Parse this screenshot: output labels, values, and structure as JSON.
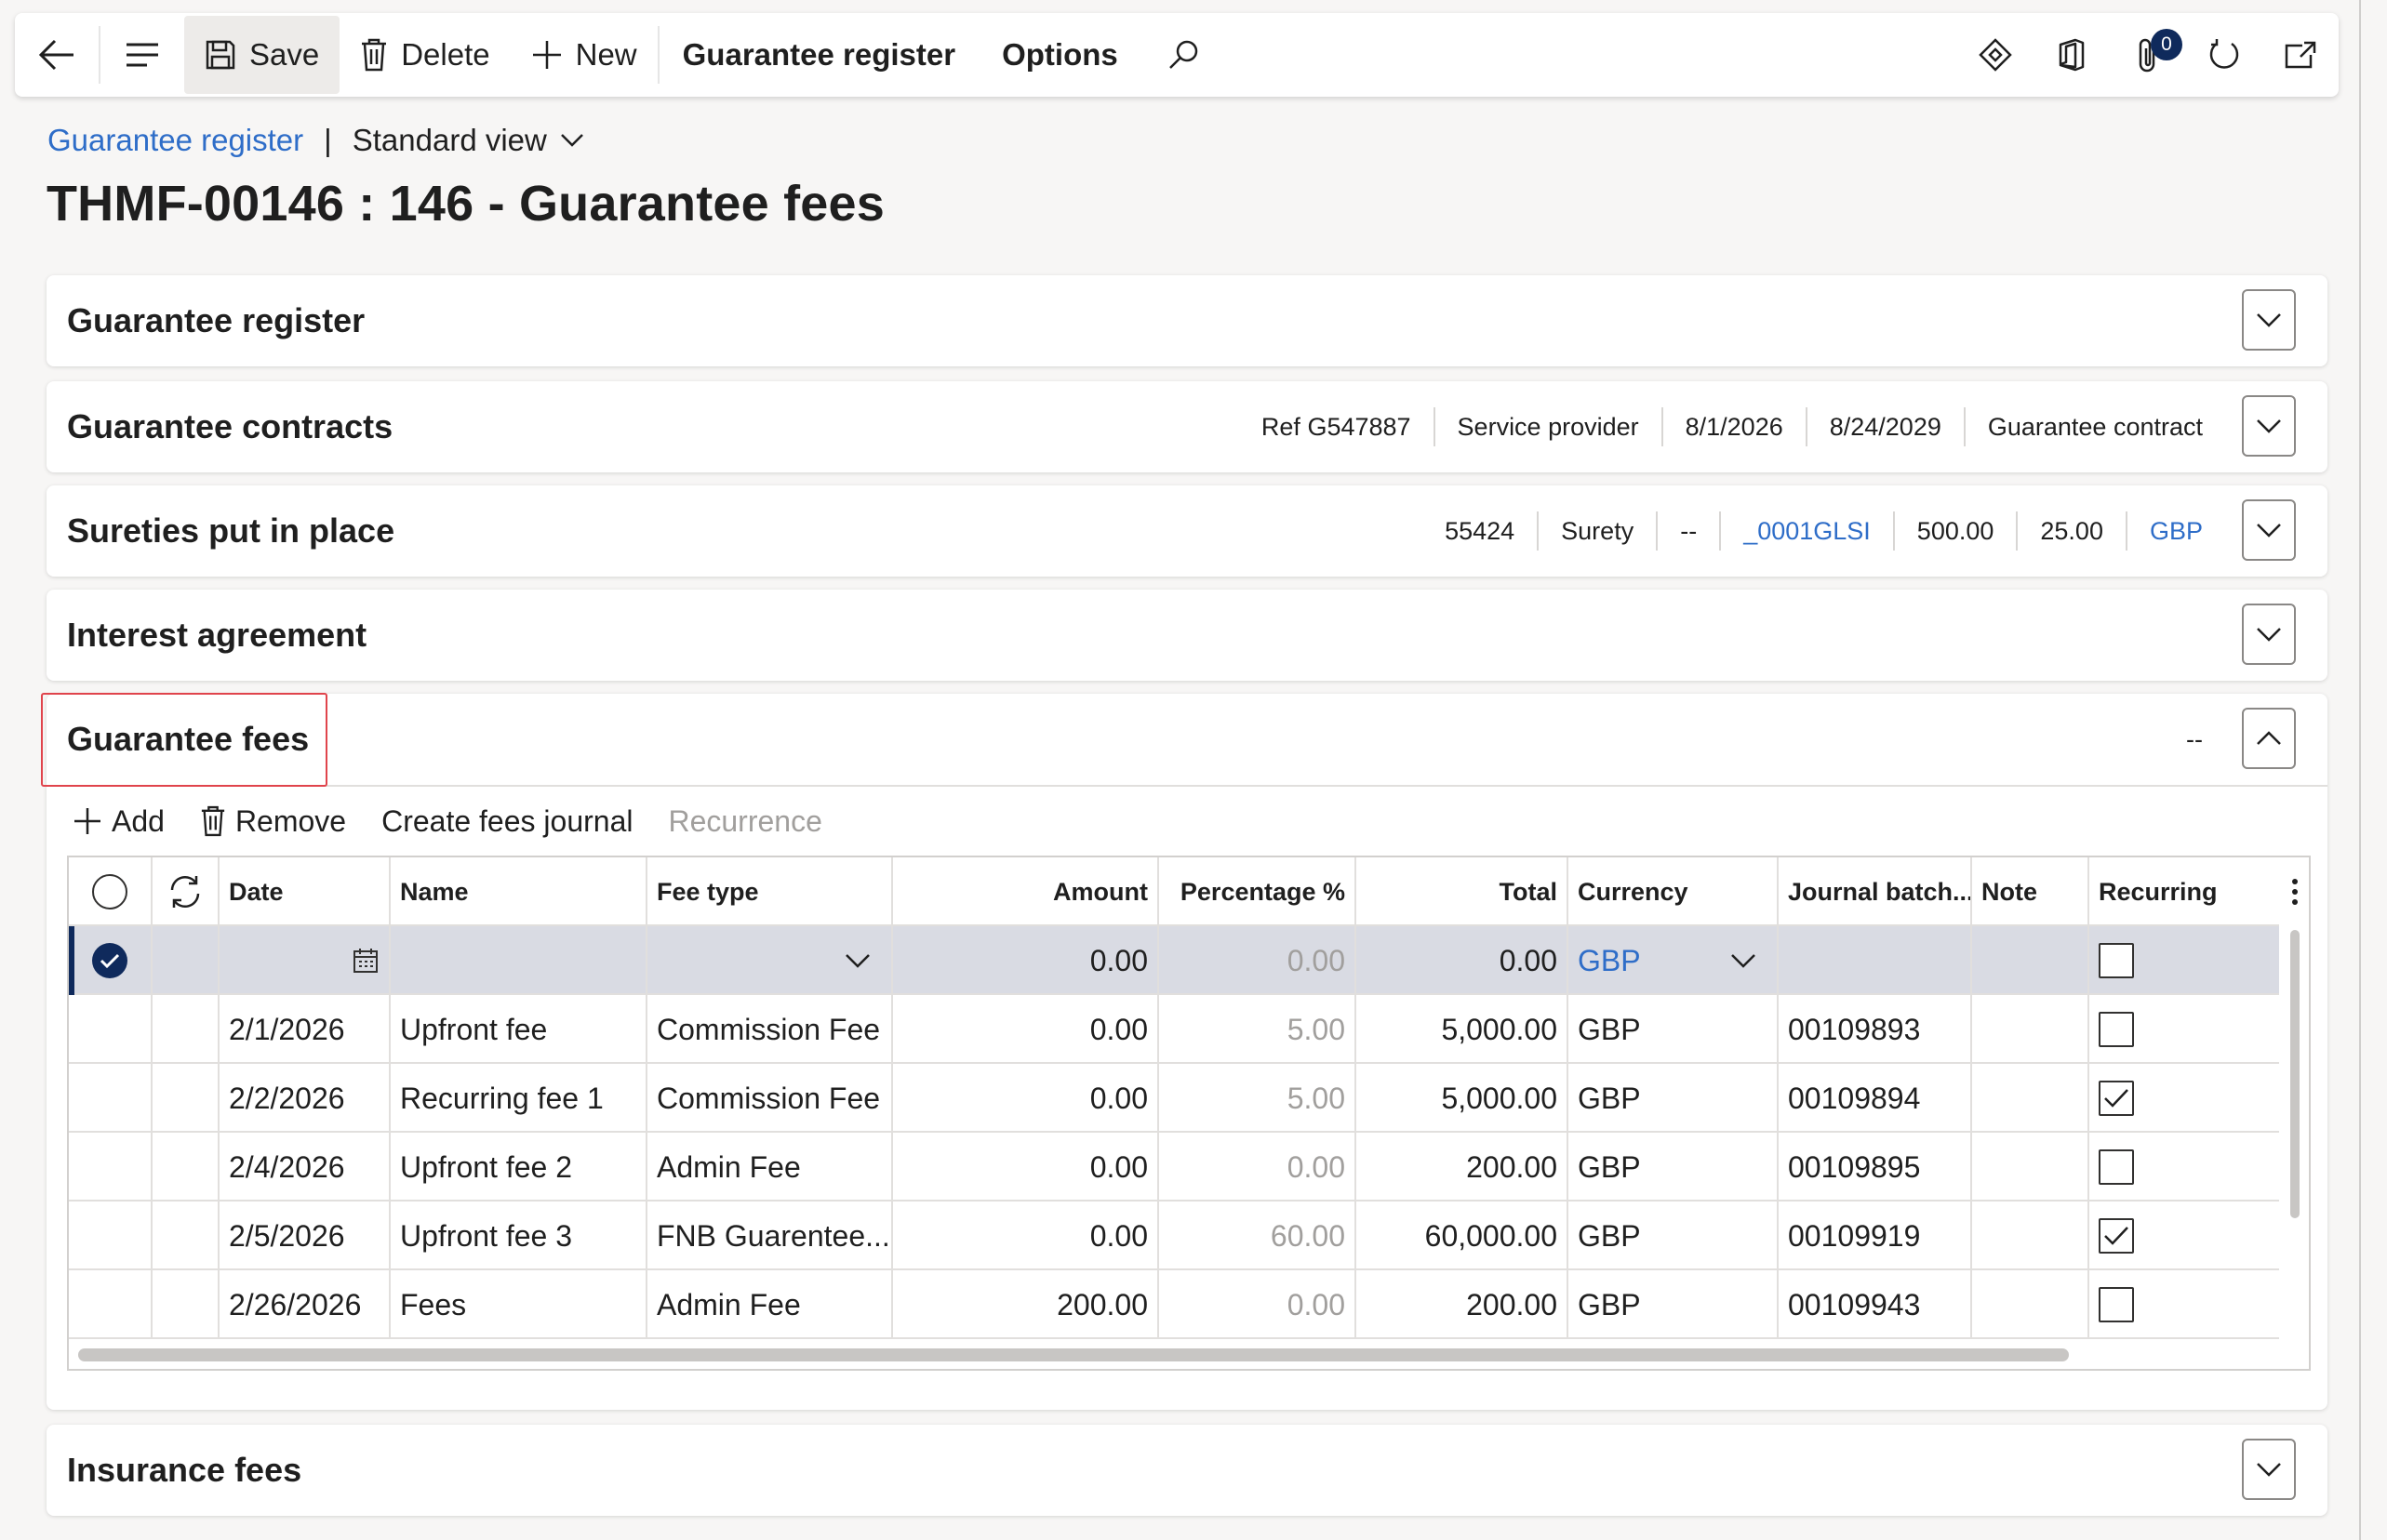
{
  "toolbar": {
    "save_label": "Save",
    "delete_label": "Delete",
    "new_label": "New",
    "guarantee_register_label": "Guarantee register",
    "options_label": "Options",
    "attachments_count": "0"
  },
  "breadcrumb": {
    "link": "Guarantee register",
    "separator": "|",
    "view": "Standard view"
  },
  "page_title": "THMF-00146 : 146 - Guarantee fees",
  "sections": {
    "guarantee_register": {
      "title": "Guarantee register"
    },
    "guarantee_contracts": {
      "title": "Guarantee contracts",
      "summary": [
        "Ref G547887",
        "Service provider",
        "8/1/2026",
        "8/24/2029",
        "Guarantee contract"
      ]
    },
    "sureties": {
      "title": "Sureties put in place",
      "summary": [
        "55424",
        "Surety",
        "--",
        "_0001GLSI",
        "500.00",
        "25.00",
        "GBP"
      ]
    },
    "interest_agreement": {
      "title": "Interest agreement"
    },
    "guarantee_fees": {
      "title": "Guarantee fees",
      "summary": "--"
    },
    "insurance_fees": {
      "title": "Insurance fees"
    }
  },
  "fee_actions": {
    "add": "Add",
    "remove": "Remove",
    "create_journal": "Create fees journal",
    "recurrence": "Recurrence"
  },
  "grid": {
    "columns": [
      "Date",
      "Name",
      "Fee type",
      "Amount",
      "Percentage %",
      "Total",
      "Currency",
      "Journal batch...",
      "Note",
      "Recurring"
    ],
    "new_row": {
      "amount": "0.00",
      "percentage": "0.00",
      "total": "0.00",
      "currency": "GBP"
    },
    "rows": [
      {
        "date": "2/1/2026",
        "name": "Upfront fee",
        "fee_type": "Commission Fee",
        "amount": "0.00",
        "percentage": "5.00",
        "total": "5,000.00",
        "currency": "GBP",
        "journal": "00109893",
        "note": "",
        "recurring": false
      },
      {
        "date": "2/2/2026",
        "name": "Recurring fee 1",
        "fee_type": "Commission Fee",
        "amount": "0.00",
        "percentage": "5.00",
        "total": "5,000.00",
        "currency": "GBP",
        "journal": "00109894",
        "note": "",
        "recurring": true
      },
      {
        "date": "2/4/2026",
        "name": "Upfront fee 2",
        "fee_type": "Admin Fee",
        "amount": "0.00",
        "percentage": "0.00",
        "total": "200.00",
        "currency": "GBP",
        "journal": "00109895",
        "note": "",
        "recurring": false
      },
      {
        "date": "2/5/2026",
        "name": "Upfront fee 3",
        "fee_type": "FNB Guarentee...",
        "amount": "0.00",
        "percentage": "60.00",
        "total": "60,000.00",
        "currency": "GBP",
        "journal": "00109919",
        "note": "",
        "recurring": true
      },
      {
        "date": "2/26/2026",
        "name": "Fees",
        "fee_type": "Admin Fee",
        "amount": "200.00",
        "percentage": "0.00",
        "total": "200.00",
        "currency": "GBP",
        "journal": "00109943",
        "note": "",
        "recurring": false
      }
    ]
  },
  "colors": {
    "accent": "#2e6dc8",
    "selection": "#0f2a5c",
    "highlight": "#e0444c"
  }
}
